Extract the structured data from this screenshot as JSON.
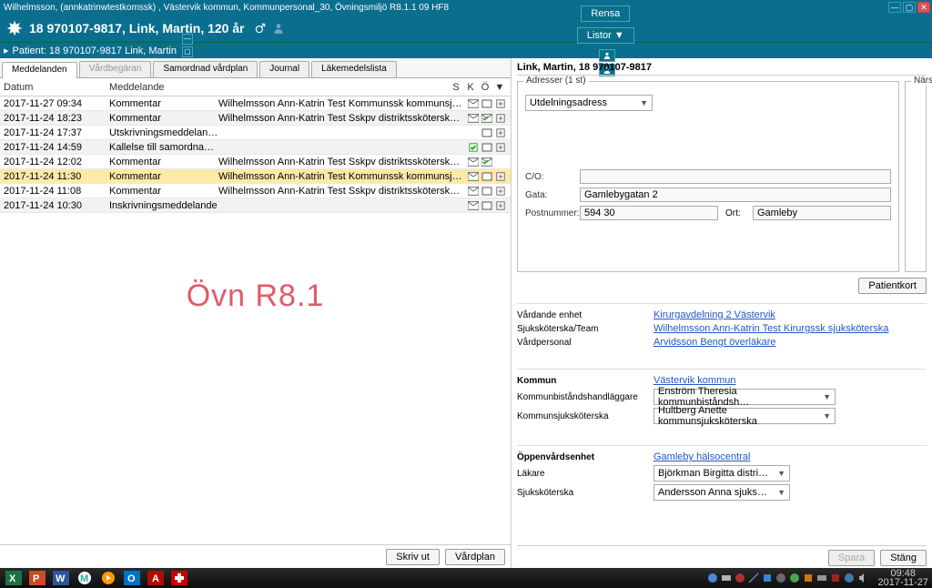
{
  "window": {
    "title": "Wilhelmsson, (annkatrinwtestkomssk) , Västervik kommun, Kommunpersonal_30, Övningsmiljö R8.1.1 09 HF8"
  },
  "header": {
    "patient_line": "18 970107-9817,  Link, Martin,  120 år",
    "rensa": "Rensa",
    "listor": "Listor ▼"
  },
  "subbar": {
    "patient": "Patient: 18 970107-9817 Link, Martin"
  },
  "tabs": {
    "meddelanden": "Meddelanden",
    "vardbegaran": "Vårdbegäran",
    "samordnad": "Samordnad vårdplan",
    "journal": "Journal",
    "lakemedel": "Läkemedelslista"
  },
  "thead": {
    "datum": "Datum",
    "meddelande": "Meddelande",
    "s": "S",
    "k": "K",
    "o": "Ö"
  },
  "rows": [
    {
      "date": "2017-11-27 09:34",
      "type": "Kommentar",
      "sender": "Wilhelmsson Ann-Katrin Test Kommunssk kommunsjuksköterska Västervik kommun",
      "mail": true,
      "box": true,
      "plus": true
    },
    {
      "date": "2017-11-24 18:23",
      "type": "Kommentar",
      "sender": "Wilhelmsson Ann-Katrin Test Sskpv distriktssköterska Gamleby hälsocentral",
      "mail": true,
      "checkmail": true,
      "plus": true
    },
    {
      "date": "2017-11-24 17:37",
      "type": "Utskrivningsmeddelande",
      "sender": "",
      "box": true,
      "plus": true
    },
    {
      "date": "2017-11-24 14:59",
      "type": "Kallelse till samordnad vårdplanering",
      "sender": "",
      "greencheck": true,
      "box": true,
      "plus": true
    },
    {
      "date": "2017-11-24 12:02",
      "type": "Kommentar",
      "sender": "Wilhelmsson Ann-Katrin Test Sskpv distriktssköterska Gamleby hälsocentral",
      "mail": true,
      "checkmail": true,
      "plus": false
    },
    {
      "date": "2017-11-24 11:30",
      "type": "Kommentar",
      "sender": "Wilhelmsson Ann-Katrin Test Kommunssk kommunsjuksköterska Västervik kommun",
      "mail": true,
      "box": true,
      "plus": true,
      "selected": true
    },
    {
      "date": "2017-11-24 11:08",
      "type": "Kommentar",
      "sender": "Wilhelmsson Ann-Katrin Test Sskpv distriktssköterska Gamleby hälsocentral",
      "mail": true,
      "box": true,
      "plus": true
    },
    {
      "date": "2017-11-24 10:30",
      "type": "Inskrivningsmeddelande",
      "sender": "",
      "mail": true,
      "box": true,
      "plus": true
    }
  ],
  "watermark": "Övn R8.1",
  "lfoot": {
    "skrivut": "Skriv ut",
    "vardplan": "Vårdplan"
  },
  "rpanel": {
    "title": "Link, Martin, 18 970107-9817",
    "adresser_legend": "Adresser (1 st)",
    "narstaende_legend": "Närstående",
    "addr_select": "Utdelningsadress",
    "co_label": "C/O:",
    "co_val": "",
    "gata_label": "Gata:",
    "gata_val": "Gamlebygatan 2",
    "post_label": "Postnummer:",
    "post_val": "594 30",
    "ort_label": "Ort:",
    "ort_val": "Gamleby",
    "patientkort": "Patientkort"
  },
  "sect1": {
    "vardande_k": "Vårdande enhet",
    "vardande_v": "Kirurgavdelning 2 Västervik",
    "team_k": "Sjuksköterska/Team",
    "team_v": "Wilhelmsson Ann-Katrin Test Kirurgssk sjuksköterska",
    "vardp_k": "Vårdpersonal",
    "vardp_v": "Arvidsson Bengt överläkare"
  },
  "sect2": {
    "kommun_k": "Kommun",
    "kommun_v": "Västervik kommun",
    "hand_k": "Kommunbiståndshandläggare",
    "hand_v": "Enström Theresia kommunbiståndsh…",
    "ksjuk_k": "Kommunsjuksköterska",
    "ksjuk_v": "Hultberg Anette kommunsjuksköterska"
  },
  "sect3": {
    "ov_k": "Öppenvårdsenhet",
    "ov_v": "Gamleby hälsocentral",
    "lak_k": "Läkare",
    "lak_v": "Björkman Birgitta distri…",
    "sjuk_k": "Sjuksköterska",
    "sjuk_v": "Andersson Anna sjuks…"
  },
  "rfoot": {
    "spara": "Spara",
    "stang": "Stäng"
  },
  "taskbar": {
    "time": "09:48",
    "date": "2017-11-27"
  },
  "icons": {
    "mail": "envelope-icon",
    "mailcheck": "envelope-check-icon",
    "box": "box-icon",
    "plus": "plus-icon",
    "greencheck": "greencheck-icon"
  }
}
